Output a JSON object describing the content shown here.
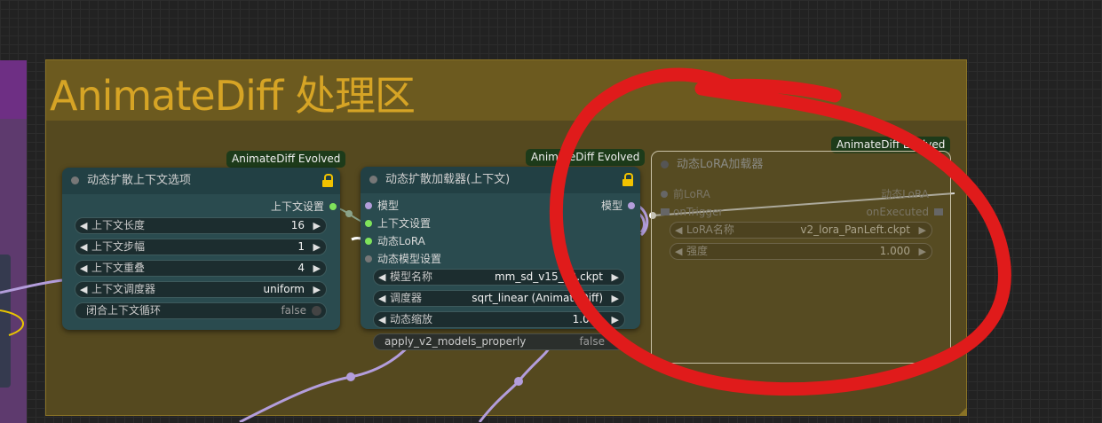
{
  "group": {
    "title": "AnimateDiff 处理区"
  },
  "node_context": {
    "badge": "AnimateDiff Evolved",
    "title": "动态扩散上下文选项",
    "output": "上下文设置",
    "widgets": [
      {
        "label": "上下文长度",
        "value": "16"
      },
      {
        "label": "上下文步幅",
        "value": "1"
      },
      {
        "label": "上下文重叠",
        "value": "4"
      },
      {
        "label": "上下文调度器",
        "value": "uniform"
      }
    ],
    "toggle": {
      "label": "闭合上下文循环",
      "value": "false"
    }
  },
  "node_loader": {
    "badge": "AnimateDiff Evolved",
    "title": "动态扩散加载器(上下文)",
    "inputs": [
      "模型",
      "上下文设置",
      "动态LoRA",
      "动态模型设置"
    ],
    "output": "模型",
    "widgets": [
      {
        "label": "模型名称",
        "value": "mm_sd_v15_v2.ckpt"
      },
      {
        "label": "调度器",
        "value": "sqrt_linear (AnimateDiff)"
      },
      {
        "label": "动态缩放",
        "value": "1.000"
      }
    ],
    "toggle": {
      "label": "apply_v2_models_properly",
      "value": "false"
    }
  },
  "node_lora": {
    "badge": "AnimateDiff Evolved",
    "title": "动态LoRA加载器",
    "input": "前LoRA",
    "output": "动态LoRA",
    "trigger_in": "onTrigger",
    "trigger_out": "onExecuted",
    "widgets": [
      {
        "label": "LoRA名称",
        "value": "v2_lora_PanLeft.ckpt"
      },
      {
        "label": "强度",
        "value": "1.000"
      }
    ]
  },
  "colors": {
    "annotation": "#e01b1b",
    "lock": "#f2c200",
    "model_link": "#b39ddb",
    "group": "#55491f"
  }
}
